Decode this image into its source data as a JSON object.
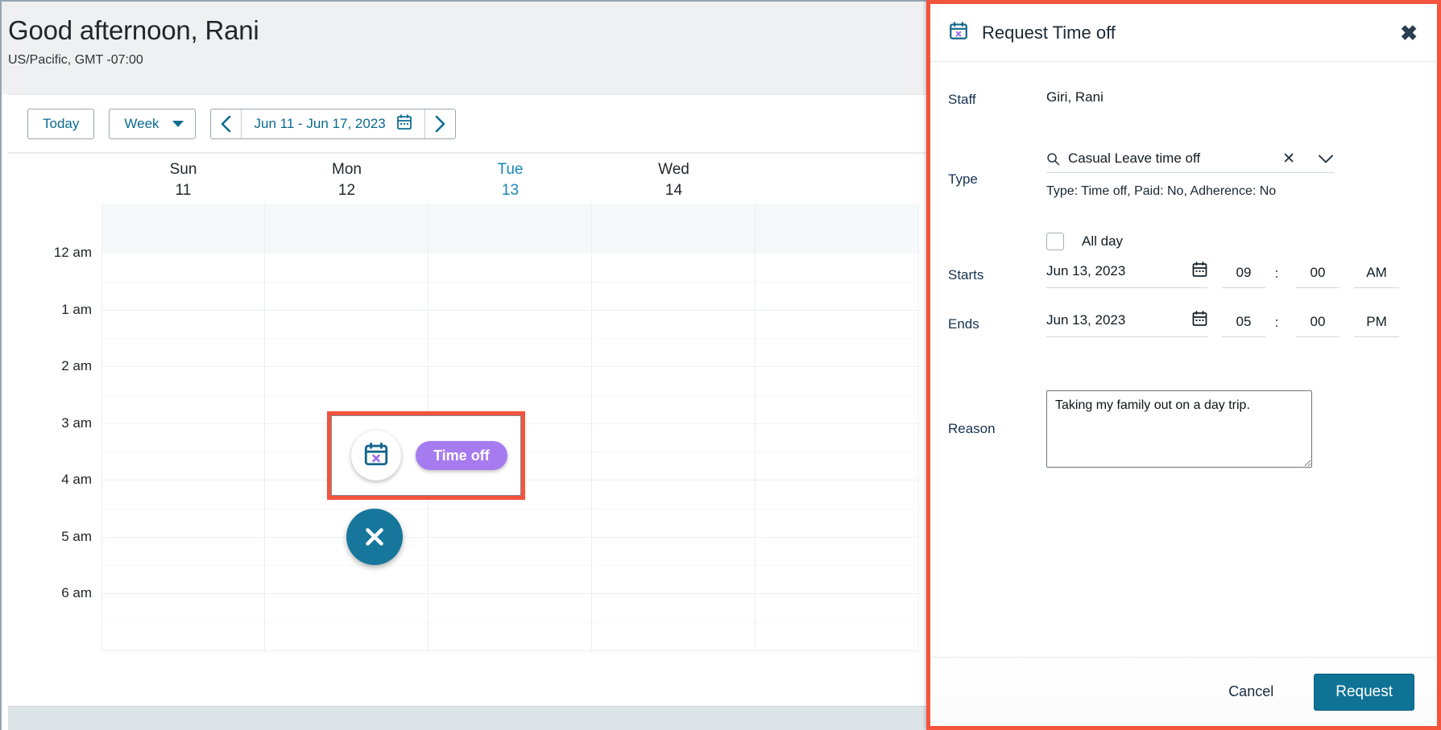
{
  "greeting": {
    "title": "Good afternoon, Rani",
    "timezone": "US/Pacific, GMT -07:00"
  },
  "toolbar": {
    "today_label": "Today",
    "view_label": "Week",
    "date_range": "Jun 11 - Jun 17, 2023",
    "prev_icon": "chevron-left-icon",
    "next_icon": "chevron-right-icon",
    "calendar_icon": "calendar-icon"
  },
  "calendar": {
    "days": [
      {
        "name": "Sun",
        "num": "11",
        "today": false
      },
      {
        "name": "Mon",
        "num": "12",
        "today": false
      },
      {
        "name": "Tue",
        "num": "13",
        "today": true
      },
      {
        "name": "Wed",
        "num": "14",
        "today": false
      },
      {
        "name": "",
        "num": "",
        "today": false
      }
    ],
    "hours": [
      "12 am",
      "1 am",
      "2 am",
      "3 am",
      "4 am",
      "5 am",
      "6 am"
    ]
  },
  "quick_action": {
    "icon_name": "calendar-x-icon",
    "pill_label": "Time off",
    "close_icon": "close-x-icon"
  },
  "dialog": {
    "icon_name": "calendar-x-icon",
    "title": "Request Time off",
    "close_label": "✖",
    "staff_label": "Staff",
    "staff_value": "Giri, Rani",
    "type_label": "Type",
    "type_value": "Casual Leave time off",
    "type_search_icon": "search-icon",
    "type_clear_icon": "clear-x-icon",
    "type_caret_icon": "chevron-down-icon",
    "type_hint": "Type: Time off, Paid: No, Adherence: No",
    "allday_label": "All day",
    "allday_checked": false,
    "starts_label": "Starts",
    "starts_date": "Jun 13, 2023",
    "starts_hour": "09",
    "starts_colon": ":",
    "starts_minute": "00",
    "starts_ampm": "AM",
    "ends_label": "Ends",
    "ends_date": "Jun 13, 2023",
    "ends_hour": "05",
    "ends_colon": ":",
    "ends_minute": "00",
    "ends_ampm": "PM",
    "reason_label": "Reason",
    "reason_value": "Taking my family out on a day trip.",
    "reason_placeholder": "",
    "cancel_label": "Cancel",
    "request_label": "Request"
  },
  "colors": {
    "accent_blue": "#0f7396",
    "link_blue": "#0a6a8f",
    "today_blue": "#1787b8",
    "highlight_red": "#f4543c",
    "pill_purple": "#a77bf0",
    "header_bg": "#eff0f1"
  }
}
